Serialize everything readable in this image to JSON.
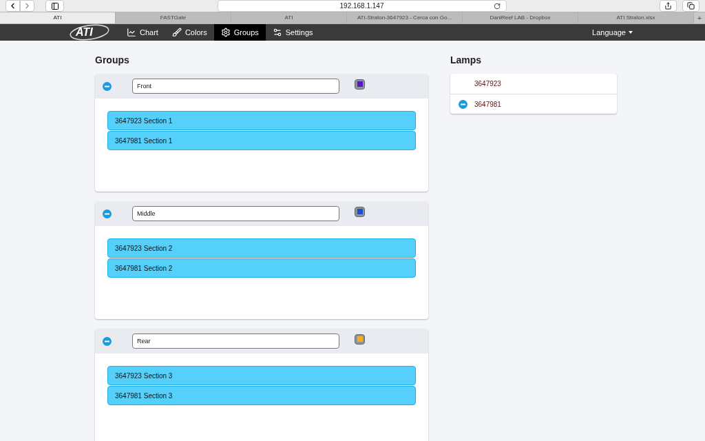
{
  "browser": {
    "address": "192.168.1.147",
    "tabs": [
      {
        "label": "ATI",
        "selected": true
      },
      {
        "label": "FASTGate",
        "selected": false
      },
      {
        "label": "ATI",
        "selected": false
      },
      {
        "label": "ATI-Straton-3647923 - Cerca con Go...",
        "selected": false
      },
      {
        "label": "DaniReef LAB - Dropbox",
        "selected": false
      },
      {
        "label": "ATI Straton.xlsx",
        "selected": false
      }
    ],
    "new_tab": "+"
  },
  "navbar": {
    "logo": "ATI",
    "items": [
      {
        "label": "Chart",
        "selected": false
      },
      {
        "label": "Colors",
        "selected": false
      },
      {
        "label": "Groups",
        "selected": true
      },
      {
        "label": "Settings",
        "selected": false
      }
    ],
    "language": "Language"
  },
  "groups": {
    "title": "Groups",
    "items": [
      {
        "name": "Front",
        "color": "#5b16c8",
        "members": [
          "3647923 Section 1",
          "3647981 Section 1"
        ]
      },
      {
        "name": "Middle",
        "color": "#1f4fc8",
        "members": [
          "3647923 Section 2",
          "3647981 Section 2"
        ]
      },
      {
        "name": "Rear",
        "color": "#f2b11c",
        "members": [
          "3647923 Section 3",
          "3647981 Section 3"
        ]
      }
    ]
  },
  "lamps": {
    "title": "Lamps",
    "items": [
      {
        "id": "3647923",
        "removable": false
      },
      {
        "id": "3647981",
        "removable": true
      }
    ]
  }
}
